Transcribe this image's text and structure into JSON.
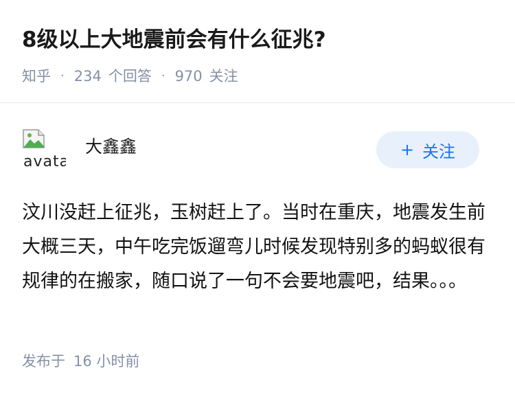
{
  "question": {
    "title": "8级以上大地震前会有什么征兆?",
    "source": "知乎",
    "answers_count": "234",
    "answers_label": "个回答",
    "followers_count": "970",
    "followers_label": "关注",
    "separator": "·"
  },
  "answer": {
    "author": {
      "name": "大鑫鑫",
      "avatar_alt": "avatar"
    },
    "follow_button": {
      "icon": "+",
      "label": "关注"
    },
    "content": "汶川没赶上征兆，玉树赶上了。当时在重庆，地震发生前大概三天，中午吃完饭遛弯儿时候发现特别多的蚂蚁很有规律的在搬家，随口说了一句不会要地震吧，结果。。。",
    "published_prefix": "发布于",
    "published_time": "16 小时前"
  },
  "colors": {
    "accent": "#1772f6",
    "follow_bg": "#e8f1fb",
    "meta_text": "#8590a6"
  },
  "icons": {
    "avatar": "broken-image-icon"
  }
}
